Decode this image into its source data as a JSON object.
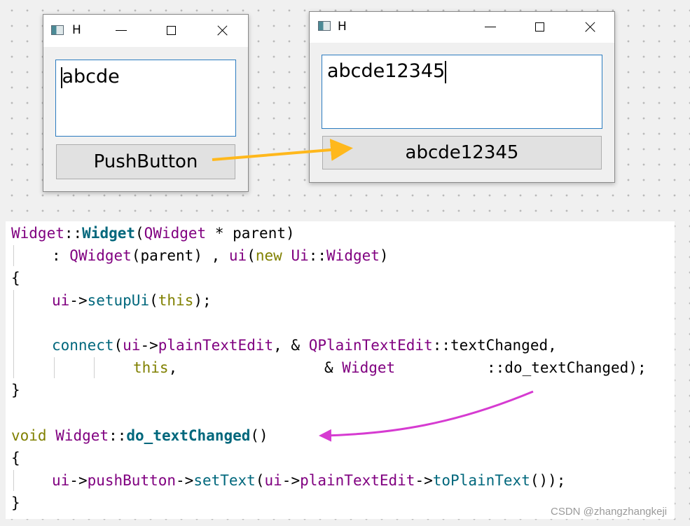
{
  "left_window": {
    "title": "H",
    "text_edit_value": "abcde",
    "button_label": "PushButton"
  },
  "right_window": {
    "title": "H",
    "text_edit_value": "abcde12345",
    "button_label": "abcde12345"
  },
  "code": {
    "l1": {
      "a": "Widget",
      "b": "::",
      "c": "Widget",
      "d": "(",
      "e": "QWidget",
      "f": " * parent)"
    },
    "l2": {
      "a": ": ",
      "b": "QWidget",
      "c": "(parent) , ",
      "d": "ui",
      "e": "(",
      "f": "new",
      "g": " ",
      "h": "Ui",
      "i": "::",
      "j": "Widget",
      "k": ")"
    },
    "l3": "{",
    "l4": {
      "a": "ui",
      "b": "->",
      "c": "setupUi",
      "d": "(",
      "e": "this",
      "f": ");"
    },
    "l5": {
      "a": "connect",
      "b": "(",
      "c": "ui",
      "d": "->",
      "e": "plainTextEdit",
      "f": ", & ",
      "g": "QPlainTextEdit",
      "h": "::",
      "i": "textChanged",
      "j": ","
    },
    "l6": {
      "a": "this",
      "b": ",",
      "c": "& ",
      "d": "Widget",
      "e": "::",
      "f": "do_textChanged",
      "g": ");"
    },
    "l7": "}",
    "l8": {
      "a": "void",
      "b": " ",
      "c": "Widget",
      "d": "::",
      "e": "do_textChanged",
      "f": "()"
    },
    "l9": "{",
    "l10": {
      "a": "ui",
      "b": "->",
      "c": "pushButton",
      "d": "->",
      "e": "setText",
      "f": "(",
      "g": "ui",
      "h": "->",
      "i": "plainTextEdit",
      "j": "->",
      "k": "toPlainText",
      "l": "());"
    },
    "l11": "}"
  },
  "watermark": "CSDN @zhangzhangkeji",
  "colors": {
    "arrow_orange": "#ffb81c",
    "arrow_magenta": "#d63bd1",
    "class_purple": "#800080",
    "function_teal": "#00677c",
    "keyword_olive": "#808000"
  },
  "icons": [
    "window-app-icon",
    "minimize-icon",
    "maximize-icon",
    "close-icon"
  ]
}
